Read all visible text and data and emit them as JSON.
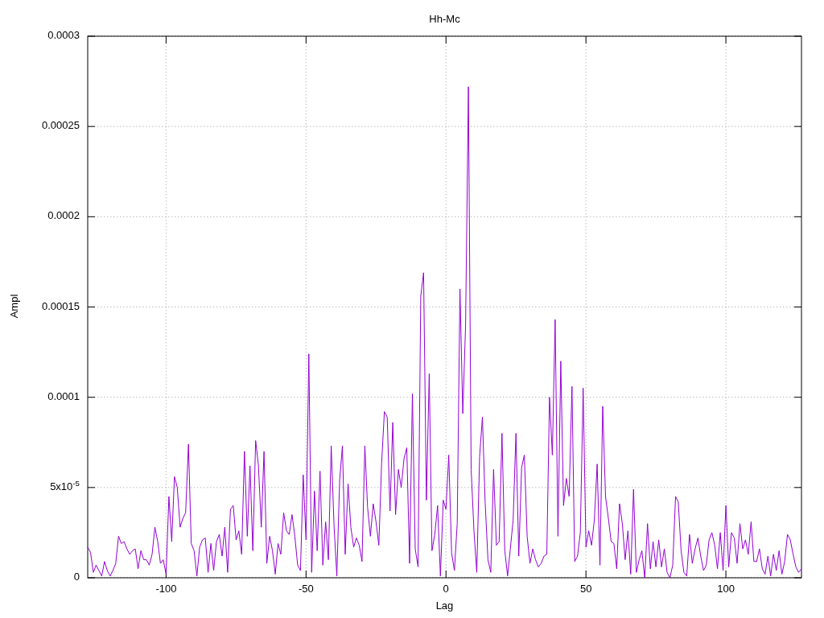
{
  "chart_data": {
    "type": "line",
    "title": "Hh-Mc",
    "xlabel": "Lag",
    "ylabel": "Ampl",
    "grid": true,
    "xlim": [
      -128,
      127
    ],
    "ylim": [
      0,
      0.0003
    ],
    "xticks": [
      -100,
      -50,
      0,
      50,
      100
    ],
    "yticks": [
      {
        "value": 0,
        "label": "0"
      },
      {
        "value": 5e-05,
        "label": "5x10$^{-5}$"
      },
      {
        "value": 0.0001,
        "label": "0.0001"
      },
      {
        "value": 0.00015,
        "label": "0.00015"
      },
      {
        "value": 0.0002,
        "label": "0.0002"
      },
      {
        "value": 0.00025,
        "label": "0.00025"
      },
      {
        "value": 0.0003,
        "label": "0.0003"
      }
    ],
    "x": [
      -128,
      -127,
      -126,
      -125,
      -124,
      -123,
      -122,
      -121,
      -120,
      -119,
      -118,
      -117,
      -116,
      -115,
      -114,
      -113,
      -112,
      -111,
      -110,
      -109,
      -108,
      -107,
      -106,
      -105,
      -104,
      -103,
      -102,
      -101,
      -100,
      -99,
      -98,
      -97,
      -96,
      -95,
      -94,
      -93,
      -92,
      -91,
      -90,
      -89,
      -88,
      -87,
      -86,
      -85,
      -84,
      -83,
      -82,
      -81,
      -80,
      -79,
      -78,
      -77,
      -76,
      -75,
      -74,
      -73,
      -72,
      -71,
      -70,
      -69,
      -68,
      -67,
      -66,
      -65,
      -64,
      -63,
      -62,
      -61,
      -60,
      -59,
      -58,
      -57,
      -56,
      -55,
      -54,
      -53,
      -52,
      -51,
      -50,
      -49,
      -48,
      -47,
      -46,
      -45,
      -44,
      -43,
      -42,
      -41,
      -40,
      -39,
      -38,
      -37,
      -36,
      -35,
      -34,
      -33,
      -32,
      -31,
      -30,
      -29,
      -28,
      -27,
      -26,
      -25,
      -24,
      -23,
      -22,
      -21,
      -20,
      -19,
      -18,
      -17,
      -16,
      -15,
      -14,
      -13,
      -12,
      -11,
      -10,
      -9,
      -8,
      -7,
      -6,
      -5,
      -4,
      -3,
      -2,
      -1,
      0,
      1,
      2,
      3,
      4,
      5,
      6,
      7,
      8,
      9,
      10,
      11,
      12,
      13,
      14,
      15,
      16,
      17,
      18,
      19,
      20,
      21,
      22,
      23,
      24,
      25,
      26,
      27,
      28,
      29,
      30,
      31,
      32,
      33,
      34,
      35,
      36,
      37,
      38,
      39,
      40,
      41,
      42,
      43,
      44,
      45,
      46,
      47,
      48,
      49,
      50,
      51,
      52,
      53,
      54,
      55,
      56,
      57,
      58,
      59,
      60,
      61,
      62,
      63,
      64,
      65,
      66,
      67,
      68,
      69,
      70,
      71,
      72,
      73,
      74,
      75,
      76,
      77,
      78,
      79,
      80,
      81,
      82,
      83,
      84,
      85,
      86,
      87,
      88,
      89,
      90,
      91,
      92,
      93,
      94,
      95,
      96,
      97,
      98,
      99,
      100,
      101,
      102,
      103,
      104,
      105,
      106,
      107,
      108,
      109,
      110,
      111,
      112,
      113,
      114,
      115,
      116,
      117,
      118,
      119,
      120,
      121,
      122,
      123,
      124,
      125,
      126,
      127
    ],
    "series": [
      {
        "color": "#9400d3",
        "values": [
          1.7e-05,
          1.4e-05,
          3e-06,
          7e-06,
          4e-06,
          1e-06,
          9e-06,
          4e-06,
          1e-06,
          4e-06,
          8e-06,
          2.3e-05,
          1.9e-05,
          2e-05,
          1.6e-05,
          1.3e-05,
          1.5e-05,
          1.6e-05,
          5e-06,
          1.5e-05,
          1e-05,
          1e-05,
          7e-06,
          1.3e-05,
          2.8e-05,
          2e-05,
          8e-06,
          1e-05,
          2e-06,
          4.5e-05,
          2e-05,
          5.6e-05,
          5e-05,
          2.8e-05,
          3.3e-05,
          3.6e-05,
          7.4e-05,
          1.9e-05,
          1.5e-05,
          1e-06,
          1.7e-05,
          2.1e-05,
          2.2e-05,
          3e-06,
          1.9e-05,
          4e-06,
          2e-05,
          2.4e-05,
          1.2e-05,
          2.8e-05,
          3e-06,
          3.8e-05,
          4e-05,
          2.1e-05,
          2.6e-05,
          1.3e-05,
          7e-05,
          2.3e-05,
          6.2e-05,
          1.5e-05,
          7.6e-05,
          6.2e-05,
          2.8e-05,
          7e-05,
          8e-06,
          2.3e-05,
          1.5e-05,
          2e-06,
          1.9e-05,
          1.3e-05,
          3.6e-05,
          2.6e-05,
          2.4e-05,
          3.5e-05,
          2.3e-05,
          7e-06,
          4e-06,
          5.7e-05,
          2.1e-05,
          0.000124,
          3e-06,
          4.8e-05,
          1.5e-05,
          5.9e-05,
          7e-06,
          3.1e-05,
          1e-05,
          7.3e-05,
          2.9e-05,
          1e-06,
          5.4e-05,
          7.3e-05,
          1.3e-05,
          5.2e-05,
          2.8e-05,
          1.7e-05,
          2.2e-05,
          1.8e-05,
          9e-06,
          7.3e-05,
          3.9e-05,
          2.3e-05,
          4.1e-05,
          3.1e-05,
          1.8e-05,
          6.3e-05,
          9.2e-05,
          8.9e-05,
          3.7e-05,
          8.6e-05,
          3.5e-05,
          6e-05,
          5e-05,
          6.6e-05,
          7.2e-05,
          8e-06,
          0.000102,
          1.6e-05,
          6e-06,
          0.000156,
          0.000169,
          4.3e-05,
          0.000113,
          1.5e-05,
          2.4e-05,
          4e-05,
          1e-06,
          4.3e-05,
          3.8e-05,
          6.8e-05,
          1.4e-05,
          4e-06,
          3e-05,
          0.00016,
          9.1e-05,
          0.00014,
          0.000272,
          6e-05,
          2.6e-05,
          3e-06,
          6.7e-05,
          8.9e-05,
          4.2e-05,
          1e-05,
          3e-06,
          6e-05,
          1.8e-05,
          2e-05,
          8e-05,
          1.5e-05,
          1e-06,
          1.6e-05,
          3.2e-05,
          8e-05,
          1.2e-05,
          6.1e-05,
          6.8e-05,
          2.3e-05,
          8e-06,
          1.6e-05,
          1e-05,
          6e-06,
          8e-06,
          1.2e-05,
          1.3e-05,
          0.0001,
          6.8e-05,
          0.000143,
          2.3e-05,
          0.00012,
          4e-05,
          5.5e-05,
          4.5e-05,
          0.000106,
          9e-06,
          1.2e-05,
          2.5e-05,
          0.000105,
          1.7e-05,
          2.6e-05,
          1.8e-05,
          3.2e-05,
          6.3e-05,
          7e-06,
          9.5e-05,
          4.5e-05,
          3.3e-05,
          2e-05,
          1.9e-05,
          5e-06,
          4.1e-05,
          3e-05,
          1e-05,
          2.6e-05,
          2e-06,
          4.9e-05,
          3e-06,
          1e-05,
          1.5e-05,
          0.0,
          3e-05,
          5e-06,
          2e-05,
          6e-06,
          2.1e-05,
          6e-06,
          1.6e-05,
          3e-06,
          0.0,
          7e-06,
          4.5e-05,
          4.2e-05,
          1.5e-05,
          3e-06,
          1e-06,
          2.4e-05,
          8e-06,
          1.6e-05,
          2.2e-05,
          1.2e-05,
          4e-06,
          7e-06,
          2.1e-05,
          2.5e-05,
          1.8e-05,
          5e-06,
          2.5e-05,
          4e-06,
          4e-05,
          6e-06,
          2.5e-05,
          2.2e-05,
          8e-06,
          3e-05,
          1.6e-05,
          2.1e-05,
          1.3e-05,
          3.1e-05,
          9e-06,
          9e-06,
          1.6e-05,
          5e-06,
          2e-06,
          1.2e-05,
          1e-06,
          1.3e-05,
          4e-06,
          1.5e-05,
          2e-06,
          9e-06,
          2.4e-05,
          2.1e-05,
          1.3e-05,
          6e-06,
          3e-06,
          5e-06
        ]
      }
    ]
  }
}
